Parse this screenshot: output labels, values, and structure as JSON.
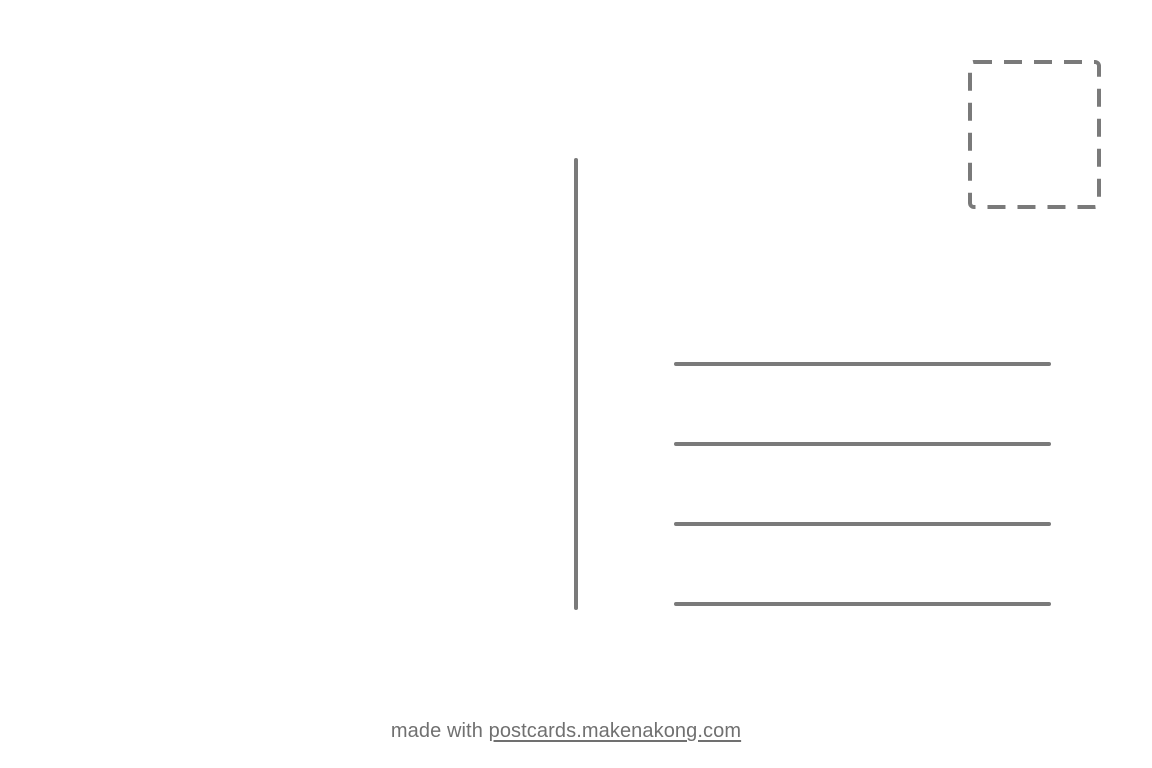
{
  "postcard": {
    "address_lines_count": 4,
    "line_color": "#7a7a7a",
    "background_color": "#ffffff"
  },
  "footer": {
    "prefix": "made with",
    "link_text": "postcards.makenakong.com"
  }
}
